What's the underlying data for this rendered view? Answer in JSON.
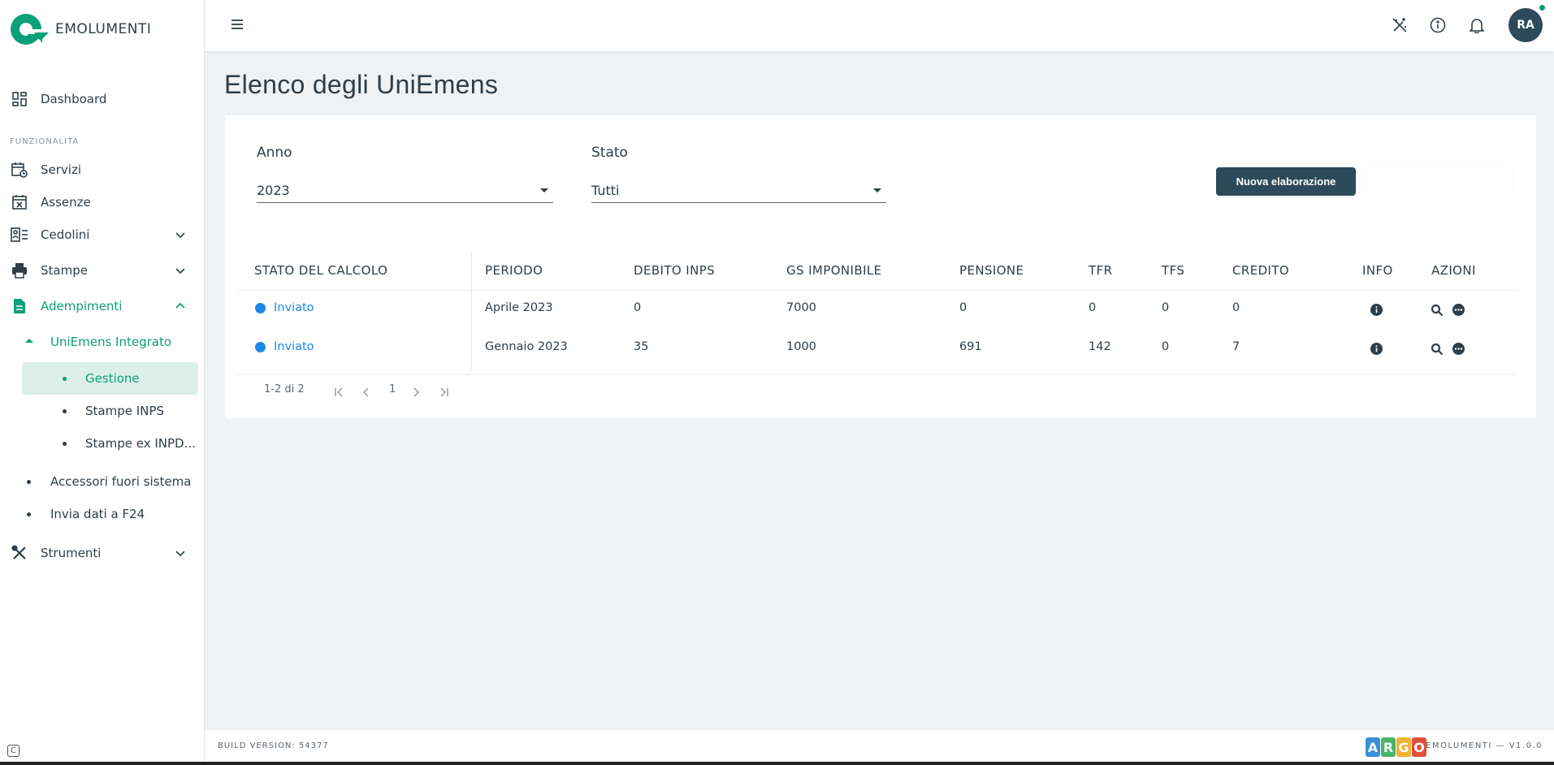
{
  "app": {
    "name": "EMOLUMENTI"
  },
  "sidebar": {
    "dashboard": "Dashboard",
    "section_label": "FUNZIONALITÀ",
    "items": [
      {
        "label": "Servizi"
      },
      {
        "label": "Assenze"
      },
      {
        "label": "Cedolini"
      },
      {
        "label": "Stampe"
      },
      {
        "label": "Adempimenti"
      },
      {
        "label": "UniEmens Integrato"
      },
      {
        "label": "Gestione"
      },
      {
        "label": "Stampe INPS"
      },
      {
        "label": "Stampe ex INPD..."
      },
      {
        "label": "Accessori fuori sistema"
      },
      {
        "label": "Invia dati a F24"
      },
      {
        "label": "Strumenti"
      }
    ]
  },
  "topbar": {
    "avatar_initials": "RA"
  },
  "main": {
    "page_title": "Elenco degli UniEmens",
    "filters": {
      "anno_label": "Anno",
      "anno_value": "2023",
      "stato_label": "Stato",
      "stato_value": "Tutti"
    },
    "new_button": "Nuova elaborazione",
    "table": {
      "headers": [
        "STATO DEL CALCOLO",
        "PERIODO",
        "DEBITO INPS",
        "GS IMPONIBILE",
        "PENSIONE",
        "TFR",
        "TFS",
        "CREDITO",
        "INFO",
        "AZIONI"
      ],
      "rows": [
        {
          "stato": "Inviato",
          "periodo": "Aprile 2023",
          "debito": "0",
          "gs": "7000",
          "pensione": "0",
          "tfr": "0",
          "tfs": "0",
          "credito": "0"
        },
        {
          "stato": "Inviato",
          "periodo": "Gennaio 2023",
          "debito": "35",
          "gs": "1000",
          "pensione": "691",
          "tfr": "142",
          "tfs": "0",
          "credito": "7"
        }
      ]
    },
    "pagination": {
      "range": "1-2 di 2",
      "page": "1"
    }
  },
  "footer": {
    "build": "BUILD VERSION: 54377",
    "brand_letters": [
      "A",
      "R",
      "G",
      "O"
    ],
    "version": "EMOLUMENTI — V1.0.0"
  },
  "colors": {
    "accent_green": "#0aa079",
    "primary_dark": "#2d4a5a",
    "link_blue": "#1e88e5",
    "argo": [
      "#3b8fd9",
      "#49b569",
      "#f2b233",
      "#e0503a"
    ]
  },
  "icons": [
    "logo-icon",
    "dashboard-icon",
    "calendar-clock-icon",
    "calendar-x-icon",
    "payslip-icon",
    "printer-icon",
    "document-icon",
    "tools-icon",
    "chevron-down-icon",
    "chevron-up-icon",
    "menu-icon",
    "magic-wand-icon",
    "info-icon",
    "bell-icon",
    "search-icon",
    "more-icon"
  ]
}
